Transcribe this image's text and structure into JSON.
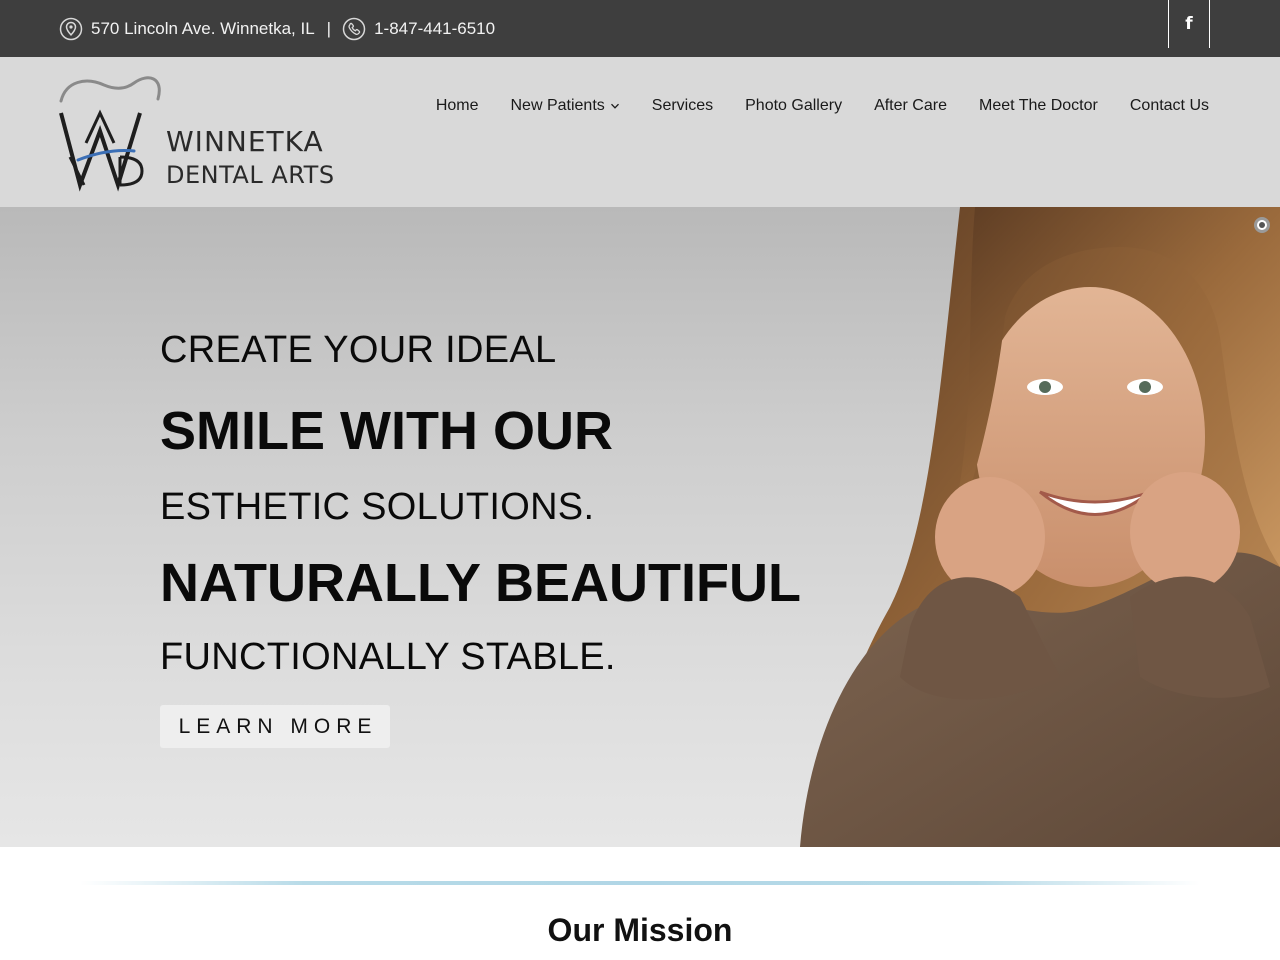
{
  "topbar": {
    "address": "570 Lincoln Ave. Winnetka, IL",
    "separator": "|",
    "phone": "1-847-441-6510",
    "address_icon": "location-pin-icon",
    "phone_icon": "phone-icon",
    "social_glyph": "f",
    "social_icon": "facebook-icon",
    "bg_color": "#3e3e3e"
  },
  "header": {
    "logo": {
      "monogram": "WDV",
      "line1": "WINNETKA",
      "line2": "DENTAL ARTS"
    },
    "nav": [
      {
        "label": "Home"
      },
      {
        "label": "New Patients",
        "has_dropdown": true
      },
      {
        "label": "Services"
      },
      {
        "label": "Photo Gallery"
      },
      {
        "label": "After Care"
      },
      {
        "label": "Meet The Doctor"
      },
      {
        "label": "Contact Us"
      }
    ],
    "bg_color": "#d9d9d9"
  },
  "hero": {
    "line1": "CREATE YOUR IDEAL",
    "line2": "SMILE WITH OUR",
    "line3": "ESTHETIC SOLUTIONS.",
    "line4": "NATURALLY BEAUTIFUL",
    "line5": "FUNCTIONALLY STABLE.",
    "button": "LEARN MORE"
  },
  "mission": {
    "title": "Our Mission"
  }
}
